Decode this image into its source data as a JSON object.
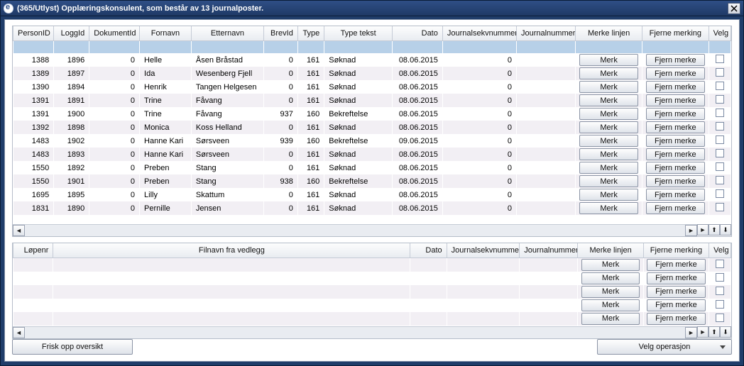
{
  "window": {
    "title": "(365/Utlyst)   Opplæringskonsulent, som består av 13 journalposter."
  },
  "buttons": {
    "refresh": "Frisk opp oversikt",
    "operation": "Velg operasjon",
    "mark": "Merk",
    "unmark": "Fjern merke"
  },
  "grid1": {
    "headers": {
      "personId": "PersonID",
      "loggId": "LoggId",
      "dokumentId": "DokumentId",
      "fornavn": "Fornavn",
      "etternavn": "Etternavn",
      "brevId": "BrevId",
      "type": "Type",
      "typeTekst": "Type tekst",
      "dato": "Dato",
      "journalsekvnummer": "Journalsekvnummer",
      "journalnummer": "Journalnummer",
      "merkeLinjen": "Merke linjen",
      "fjerneMerking": "Fjerne merking",
      "velg": "Velg"
    },
    "rows": [
      {
        "personId": "1388",
        "loggId": "1896",
        "dokumentId": "0",
        "fornavn": "Helle",
        "etternavn": "Åsen Bråstad",
        "brevId": "0",
        "type": "161",
        "typeTekst": "Søknad",
        "dato": "08.06.2015",
        "seq": "0",
        "jn": ""
      },
      {
        "personId": "1389",
        "loggId": "1897",
        "dokumentId": "0",
        "fornavn": "Ida",
        "etternavn": "Wesenberg Fjell",
        "brevId": "0",
        "type": "161",
        "typeTekst": "Søknad",
        "dato": "08.06.2015",
        "seq": "0",
        "jn": ""
      },
      {
        "personId": "1390",
        "loggId": "1894",
        "dokumentId": "0",
        "fornavn": "Henrik",
        "etternavn": "Tangen Helgesen",
        "brevId": "0",
        "type": "161",
        "typeTekst": "Søknad",
        "dato": "08.06.2015",
        "seq": "0",
        "jn": ""
      },
      {
        "personId": "1391",
        "loggId": "1891",
        "dokumentId": "0",
        "fornavn": "Trine",
        "etternavn": "Fåvang",
        "brevId": "0",
        "type": "161",
        "typeTekst": "Søknad",
        "dato": "08.06.2015",
        "seq": "0",
        "jn": ""
      },
      {
        "personId": "1391",
        "loggId": "1900",
        "dokumentId": "0",
        "fornavn": "Trine",
        "etternavn": "Fåvang",
        "brevId": "937",
        "type": "160",
        "typeTekst": "Bekreftelse",
        "dato": "08.06.2015",
        "seq": "0",
        "jn": ""
      },
      {
        "personId": "1392",
        "loggId": "1898",
        "dokumentId": "0",
        "fornavn": "Monica",
        "etternavn": "Koss Helland",
        "brevId": "0",
        "type": "161",
        "typeTekst": "Søknad",
        "dato": "08.06.2015",
        "seq": "0",
        "jn": ""
      },
      {
        "personId": "1483",
        "loggId": "1902",
        "dokumentId": "0",
        "fornavn": "Hanne Kari",
        "etternavn": "Sørsveen",
        "brevId": "939",
        "type": "160",
        "typeTekst": "Bekreftelse",
        "dato": "09.06.2015",
        "seq": "0",
        "jn": ""
      },
      {
        "personId": "1483",
        "loggId": "1893",
        "dokumentId": "0",
        "fornavn": "Hanne Kari",
        "etternavn": "Sørsveen",
        "brevId": "0",
        "type": "161",
        "typeTekst": "Søknad",
        "dato": "08.06.2015",
        "seq": "0",
        "jn": ""
      },
      {
        "personId": "1550",
        "loggId": "1892",
        "dokumentId": "0",
        "fornavn": "Preben",
        "etternavn": "Stang",
        "brevId": "0",
        "type": "161",
        "typeTekst": "Søknad",
        "dato": "08.06.2015",
        "seq": "0",
        "jn": ""
      },
      {
        "personId": "1550",
        "loggId": "1901",
        "dokumentId": "0",
        "fornavn": "Preben",
        "etternavn": "Stang",
        "brevId": "938",
        "type": "160",
        "typeTekst": "Bekreftelse",
        "dato": "08.06.2015",
        "seq": "0",
        "jn": ""
      },
      {
        "personId": "1695",
        "loggId": "1895",
        "dokumentId": "0",
        "fornavn": "Lilly",
        "etternavn": "Skattum",
        "brevId": "0",
        "type": "161",
        "typeTekst": "Søknad",
        "dato": "08.06.2015",
        "seq": "0",
        "jn": ""
      },
      {
        "personId": "1831",
        "loggId": "1890",
        "dokumentId": "0",
        "fornavn": "Pernille",
        "etternavn": "Jensen",
        "brevId": "0",
        "type": "161",
        "typeTekst": "Søknad",
        "dato": "08.06.2015",
        "seq": "0",
        "jn": ""
      }
    ]
  },
  "grid2": {
    "headers": {
      "lopenr": "Løpenr",
      "filnavn": "Filnavn fra vedlegg",
      "dato": "Dato",
      "journalsekvnummer": "Journalsekvnummer",
      "journalnummer": "Journalnummer",
      "merkeLinjen": "Merke linjen",
      "fjerneMerking": "Fjerne merking",
      "velg": "Velg"
    },
    "rowcount": 5
  }
}
